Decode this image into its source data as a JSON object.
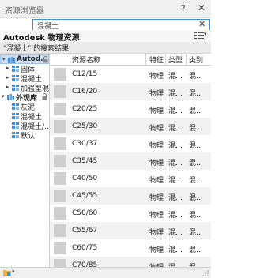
{
  "window": {
    "title": "资源浏览器",
    "help_label": "?",
    "close_label": "✕"
  },
  "search": {
    "value": "混凝土",
    "clear_label": "✕"
  },
  "library": {
    "title": "Autodesk 物理资源",
    "view_icon": "list-view-icon"
  },
  "results_header": "\"混凝土\" 的搜索结果",
  "tree": [
    {
      "label": "Autod…",
      "level": 0,
      "bold": true,
      "selected": true,
      "arrow": "▾",
      "locked": true
    },
    {
      "label": "固体",
      "level": 1,
      "arrow": "▸"
    },
    {
      "label": "混凝土",
      "level": 1,
      "arrow": "▸"
    },
    {
      "label": "加强型混…",
      "level": 1,
      "arrow": "▸"
    },
    {
      "label": "外观库",
      "level": 0,
      "bold": true,
      "arrow": "▾",
      "locked": true
    },
    {
      "label": "灰泥",
      "level": 1
    },
    {
      "label": "混凝土",
      "level": 1
    },
    {
      "label": "混凝土/…",
      "level": 1
    },
    {
      "label": "默认",
      "level": 1
    }
  ],
  "grid": {
    "columns": [
      "资源名称",
      "特征",
      "类型",
      "类别"
    ],
    "rows": [
      {
        "name": "C12/15",
        "feature": "物理",
        "type": "混…",
        "category": "混…"
      },
      {
        "name": "C16/20",
        "feature": "物理",
        "type": "混…",
        "category": "混…"
      },
      {
        "name": "C20/25",
        "feature": "物理",
        "type": "混…",
        "category": "混…"
      },
      {
        "name": "C25/30",
        "feature": "物理",
        "type": "混…",
        "category": "混…"
      },
      {
        "name": "C30/37",
        "feature": "物理",
        "type": "混…",
        "category": "混…"
      },
      {
        "name": "C35/45",
        "feature": "物理",
        "type": "混…",
        "category": "混…"
      },
      {
        "name": "C40/50",
        "feature": "物理",
        "type": "混…",
        "category": "混…"
      },
      {
        "name": "C45/55",
        "feature": "物理",
        "type": "混…",
        "category": "混…"
      },
      {
        "name": "C50/60",
        "feature": "物理",
        "type": "混…",
        "category": "混…"
      },
      {
        "name": "C55/67",
        "feature": "物理",
        "type": "混…",
        "category": "混…"
      },
      {
        "name": "C60/75",
        "feature": "物理",
        "type": "混…",
        "category": "混…"
      },
      {
        "name": "C70/85",
        "feature": "物理",
        "type": "混…",
        "category": "混…"
      }
    ]
  },
  "colors": {
    "accent": "#3d8fd1",
    "selection": "#c9def4",
    "swatch": "#cfcfcf"
  }
}
